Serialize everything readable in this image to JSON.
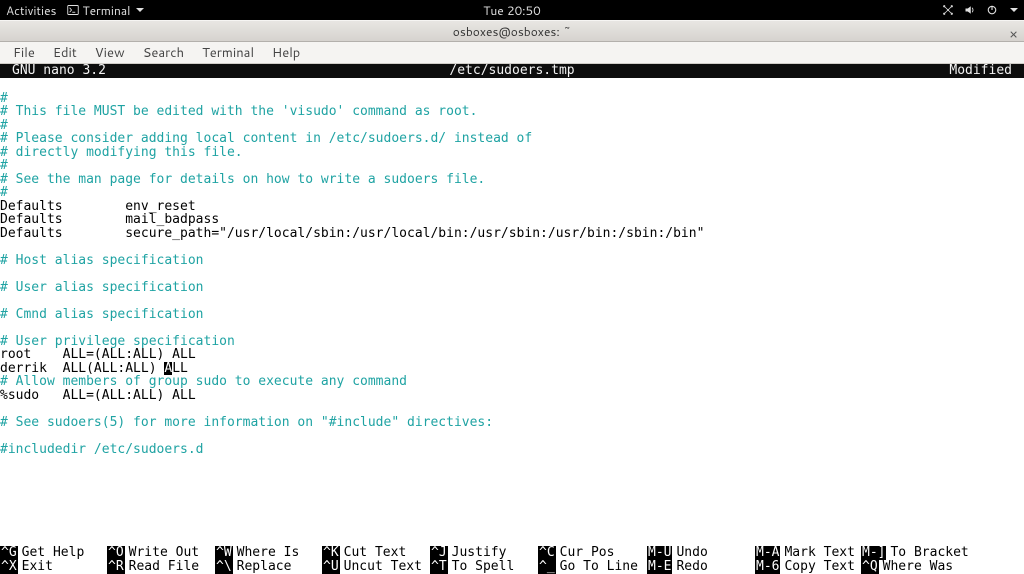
{
  "topbar": {
    "activities": "Activities",
    "app_name": "Terminal",
    "clock": "Tue 20:50"
  },
  "window": {
    "title": "osboxes@osboxes: ~"
  },
  "menubar": [
    "File",
    "Edit",
    "View",
    "Search",
    "Terminal",
    "Help"
  ],
  "nano": {
    "app": "GNU nano 3.2",
    "file": "/etc/sudoers.tmp",
    "status": "Modified",
    "lines": [
      {
        "cls": "teal",
        "t": "#"
      },
      {
        "cls": "teal",
        "t": "# This file MUST be edited with the 'visudo' command as root."
      },
      {
        "cls": "teal",
        "t": "#"
      },
      {
        "cls": "teal",
        "t": "# Please consider adding local content in /etc/sudoers.d/ instead of"
      },
      {
        "cls": "teal",
        "t": "# directly modifying this file."
      },
      {
        "cls": "teal",
        "t": "#"
      },
      {
        "cls": "teal",
        "t": "# See the man page for details on how to write a sudoers file."
      },
      {
        "cls": "teal",
        "t": "#"
      },
      {
        "cls": "black",
        "t": "Defaults        env_reset"
      },
      {
        "cls": "black",
        "t": "Defaults        mail_badpass"
      },
      {
        "cls": "black",
        "t": "Defaults        secure_path=\"/usr/local/sbin:/usr/local/bin:/usr/sbin:/usr/bin:/sbin:/bin\""
      },
      {
        "cls": "black",
        "t": ""
      },
      {
        "cls": "teal",
        "t": "# Host alias specification"
      },
      {
        "cls": "black",
        "t": ""
      },
      {
        "cls": "teal",
        "t": "# User alias specification"
      },
      {
        "cls": "black",
        "t": ""
      },
      {
        "cls": "teal",
        "t": "# Cmnd alias specification"
      },
      {
        "cls": "black",
        "t": ""
      },
      {
        "cls": "teal",
        "t": "# User privilege specification"
      },
      {
        "cls": "black",
        "t": "root    ALL=(ALL:ALL) ALL"
      }
    ],
    "cursor_line": {
      "pre": "derrik  ALL(ALL:ALL) ",
      "cursor": "A",
      "post": "LL"
    },
    "lines_after": [
      {
        "cls": "teal",
        "t": "# Allow members of group sudo to execute any command"
      },
      {
        "cls": "black",
        "t": "%sudo   ALL=(ALL:ALL) ALL"
      },
      {
        "cls": "black",
        "t": ""
      },
      {
        "cls": "teal",
        "t": "# See sudoers(5) for more information on \"#include\" directives:"
      },
      {
        "cls": "black",
        "t": ""
      },
      {
        "cls": "teal",
        "t": "#includedir /etc/sudoers.d"
      }
    ],
    "footer": [
      [
        {
          "k": "^G",
          "l": "Get Help"
        },
        {
          "k": "^O",
          "l": "Write Out"
        },
        {
          "k": "^W",
          "l": "Where Is"
        },
        {
          "k": "^K",
          "l": "Cut Text"
        },
        {
          "k": "^J",
          "l": "Justify"
        },
        {
          "k": "^C",
          "l": "Cur Pos"
        },
        {
          "k": "M-U",
          "l": "Undo"
        },
        {
          "k": "M-A",
          "l": "Mark Text"
        },
        {
          "k": "M-]",
          "l": "To Bracket"
        }
      ],
      [
        {
          "k": "^X",
          "l": "Exit"
        },
        {
          "k": "^R",
          "l": "Read File"
        },
        {
          "k": "^\\",
          "l": "Replace"
        },
        {
          "k": "^U",
          "l": "Uncut Text"
        },
        {
          "k": "^T",
          "l": "To Spell"
        },
        {
          "k": "^_",
          "l": "Go To Line"
        },
        {
          "k": "M-E",
          "l": "Redo"
        },
        {
          "k": "M-6",
          "l": "Copy Text"
        },
        {
          "k": "^Q",
          "l": "Where Was"
        }
      ]
    ]
  }
}
